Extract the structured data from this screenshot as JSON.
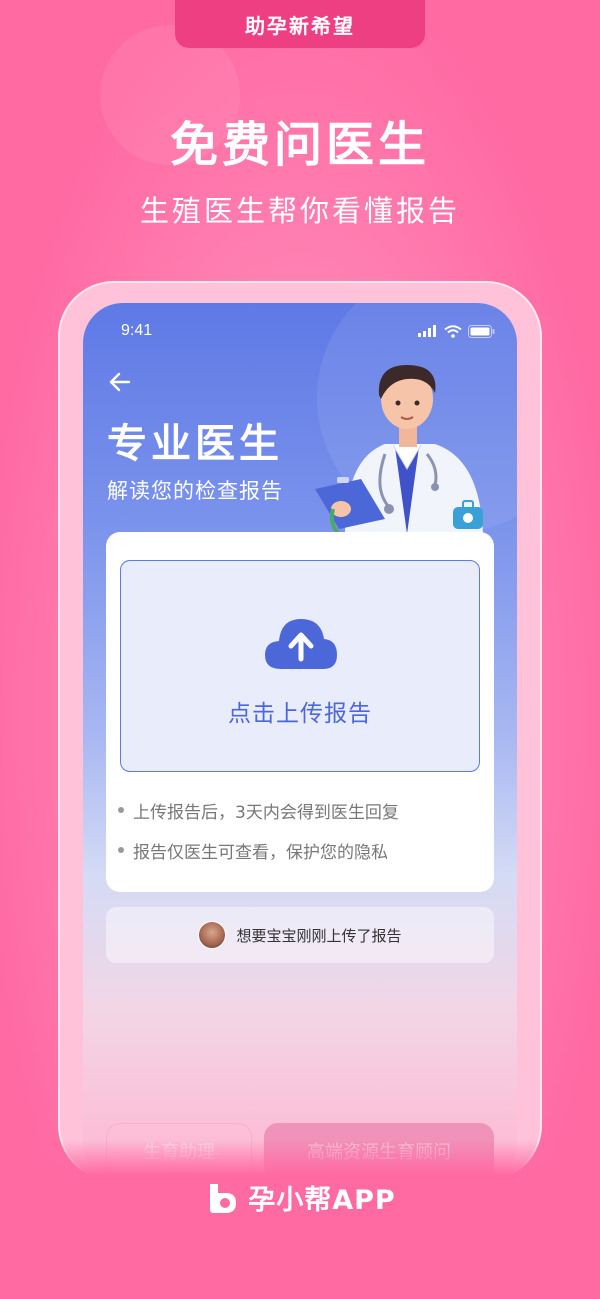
{
  "banner": {
    "tag": "助孕新希望",
    "title": "免费问医生",
    "subtitle": "生殖医生帮你看懂报告"
  },
  "status_bar": {
    "time": "9:41"
  },
  "screen": {
    "title": "专业医生",
    "subtitle": "解读您的检查报告",
    "upload_label": "点击上传报告",
    "tips": [
      "上传报告后，3天内会得到医生回复",
      "报告仅医生可查看，保护您的隐私"
    ],
    "notice": "想要宝宝刚刚上传了报告",
    "buttons": [
      "生育助理",
      "高端资源生育顾问"
    ]
  },
  "brand": {
    "name": "孕小帮APP"
  },
  "colors": {
    "pink": "#ff6aa3",
    "deep_pink": "#ee3f83",
    "blue": "#5f79e6",
    "upload_text": "#4c67d8"
  },
  "icons": {
    "back": "arrow-left-icon",
    "upload": "cloud-upload-icon",
    "signal": "signal-icon",
    "wifi": "wifi-icon",
    "battery": "battery-icon",
    "doctor": "doctor-illustration",
    "logo": "brand-logo-icon"
  }
}
